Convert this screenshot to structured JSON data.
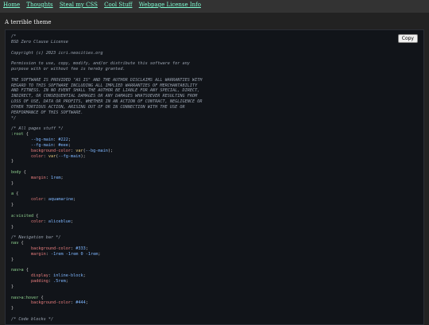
{
  "nav": {
    "links": [
      "Home",
      "Thoughts",
      "Steal my CSS",
      "Cool Stuff",
      "Webpage License Info"
    ]
  },
  "subtitle": "A terrible theme",
  "copy_button": "Copy",
  "code_lines": [
    [
      [
        "c",
        "/*"
      ]
    ],
    [
      [
        "c",
        "BSD Zero Clause License"
      ]
    ],
    [],
    [
      [
        "c",
        "Copyright (c) 2023 icri.neocities.org"
      ]
    ],
    [],
    [
      [
        "c",
        "Permission to use, copy, modify, and/or distribute this software for any"
      ]
    ],
    [
      [
        "c",
        "purpose with or without fee is hereby granted."
      ]
    ],
    [],
    [
      [
        "c",
        "THE SOFTWARE IS PROVIDED \"AS IS\" AND THE AUTHOR DISCLAIMS ALL WARRANTIES WITH"
      ]
    ],
    [
      [
        "c",
        "REGARD TO THIS SOFTWARE INCLUDING ALL IMPLIED WARRANTIES OF MERCHANTABILITY"
      ]
    ],
    [
      [
        "c",
        "AND FITNESS. IN NO EVENT SHALL THE AUTHOR BE LIABLE FOR ANY SPECIAL, DIRECT,"
      ]
    ],
    [
      [
        "c",
        "INDIRECT, OR CONSEQUENTIAL DAMAGES OR ANY DAMAGES WHATSOEVER RESULTING FROM"
      ]
    ],
    [
      [
        "c",
        "LOSS OF USE, DATA OR PROFITS, WHETHER IN AN ACTION OF CONTRACT, NEGLIGENCE OR"
      ]
    ],
    [
      [
        "c",
        "OTHER TORTIOUS ACTION, ARISING OUT OF OR IN CONNECTION WITH THE USE OR"
      ]
    ],
    [
      [
        "c",
        "PERFORMANCE OF THIS SOFTWARE."
      ]
    ],
    [
      [
        "c",
        "*/"
      ]
    ],
    [],
    [
      [
        "c",
        "/* All pages stuff */"
      ]
    ],
    [
      [
        "sel",
        ":root"
      ],
      [
        "p",
        " {"
      ]
    ],
    [
      [
        "v",
        "        --bg-main"
      ],
      [
        "p",
        ": "
      ],
      [
        "v",
        "#222"
      ],
      [
        "p",
        ";"
      ]
    ],
    [
      [
        "v",
        "        --fg-main"
      ],
      [
        "p",
        ": "
      ],
      [
        "v",
        "#eee"
      ],
      [
        "p",
        ";"
      ]
    ],
    [
      [
        "pr",
        "        background-color"
      ],
      [
        "p",
        ": "
      ],
      [
        "fn",
        "var"
      ],
      [
        "p",
        "("
      ],
      [
        "v",
        "--bg-main"
      ],
      [
        "p",
        ");"
      ]
    ],
    [
      [
        "pr",
        "        color"
      ],
      [
        "p",
        ": "
      ],
      [
        "fn",
        "var"
      ],
      [
        "p",
        "("
      ],
      [
        "v",
        "--fg-main"
      ],
      [
        "p",
        ");"
      ]
    ],
    [
      [
        "p",
        "}"
      ]
    ],
    [],
    [
      [
        "sel",
        "body"
      ],
      [
        "p",
        " {"
      ]
    ],
    [
      [
        "pr",
        "        margin"
      ],
      [
        "p",
        ": "
      ],
      [
        "v",
        "1rem"
      ],
      [
        "p",
        ";"
      ]
    ],
    [
      [
        "p",
        "}"
      ]
    ],
    [],
    [
      [
        "sel",
        "a"
      ],
      [
        "p",
        " {"
      ]
    ],
    [
      [
        "pr",
        "        color"
      ],
      [
        "p",
        ": "
      ],
      [
        "v",
        "aquamarine"
      ],
      [
        "p",
        ";"
      ]
    ],
    [
      [
        "p",
        "}"
      ]
    ],
    [],
    [
      [
        "sel",
        "a:visited"
      ],
      [
        "p",
        " {"
      ]
    ],
    [
      [
        "pr",
        "        color"
      ],
      [
        "p",
        ": "
      ],
      [
        "v",
        "aliceblue"
      ],
      [
        "p",
        ";"
      ]
    ],
    [
      [
        "p",
        "}"
      ]
    ],
    [],
    [
      [
        "c",
        "/* Navigation bar */"
      ]
    ],
    [
      [
        "sel",
        "nav"
      ],
      [
        "p",
        " {"
      ]
    ],
    [
      [
        "pr",
        "        background-color"
      ],
      [
        "p",
        ": "
      ],
      [
        "v",
        "#333"
      ],
      [
        "p",
        ";"
      ]
    ],
    [
      [
        "pr",
        "        margin"
      ],
      [
        "p",
        ": "
      ],
      [
        "v",
        "-1rem -1rem 0 -1rem"
      ],
      [
        "p",
        ";"
      ]
    ],
    [
      [
        "p",
        "}"
      ]
    ],
    [],
    [
      [
        "sel",
        "nav>a"
      ],
      [
        "p",
        " {"
      ]
    ],
    [
      [
        "pr",
        "        display"
      ],
      [
        "p",
        ": "
      ],
      [
        "v",
        "inline-block"
      ],
      [
        "p",
        ";"
      ]
    ],
    [
      [
        "pr",
        "        padding"
      ],
      [
        "p",
        ": "
      ],
      [
        "v",
        ".5rem"
      ],
      [
        "p",
        ";"
      ]
    ],
    [
      [
        "p",
        "}"
      ]
    ],
    [],
    [
      [
        "sel",
        "nav>a:hover"
      ],
      [
        "p",
        " {"
      ]
    ],
    [
      [
        "pr",
        "        background-color"
      ],
      [
        "p",
        ": "
      ],
      [
        "v",
        "#444"
      ],
      [
        "p",
        ";"
      ]
    ],
    [
      [
        "p",
        "}"
      ]
    ],
    [],
    [
      [
        "c",
        "/* Code blocks */"
      ]
    ]
  ]
}
